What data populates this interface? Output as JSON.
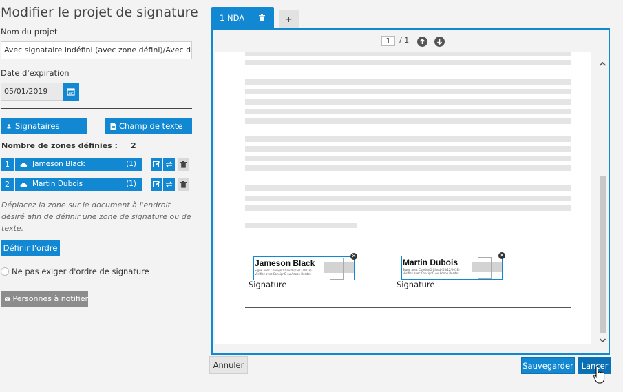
{
  "title": "Modifier le projet de signature",
  "project": {
    "label": "Nom du projet",
    "value": "Avec signataire indéfini (avec zone défini)/Avec docu"
  },
  "expiration": {
    "label": "Date d'expiration",
    "value": "05/01/2019"
  },
  "tabs_left": {
    "signers": "Signataires",
    "text_field": "Champ de texte"
  },
  "zones": {
    "label": "Nombre de zones définies :",
    "count": "2",
    "items": [
      {
        "num": "1",
        "name": "Jameson Black",
        "count": "(1)"
      },
      {
        "num": "2",
        "name": "Martin Dubois",
        "count": "(1)"
      }
    ]
  },
  "hint": "Déplacez la zone sur le document à l'endroit désiré afin de définir une zone de signature ou de texte.",
  "order_button": "Définir l'ordre",
  "no_order_label": "Ne pas exiger d'ordre de signature",
  "notify_button": "Personnes à notifier",
  "doc_tabs": [
    {
      "label": "1 NDA"
    },
    {
      "label": "+"
    }
  ],
  "pager": {
    "current": "1",
    "total": "/ 1"
  },
  "signatures": [
    {
      "name": "Jameson Black",
      "line1": "Signé avec ConsignO Cloud (05/12/2018)",
      "line2": "Vérifiez avec ConsignO ou Adobe Reader.",
      "label": "Signature"
    },
    {
      "name": "Martin Dubois",
      "line1": "Signé avec ConsignO Cloud (05/12/2018)",
      "line2": "Vérifiez avec ConsignO ou Adobe Reader.",
      "label": "Signature"
    }
  ],
  "buttons": {
    "cancel": "Annuler",
    "save": "Sauvegarder",
    "launch": "Lancer"
  },
  "colors": {
    "accent": "#1188d1",
    "tab_inactive": "#e2e2e2",
    "muted_button": "#8c8c8c"
  }
}
